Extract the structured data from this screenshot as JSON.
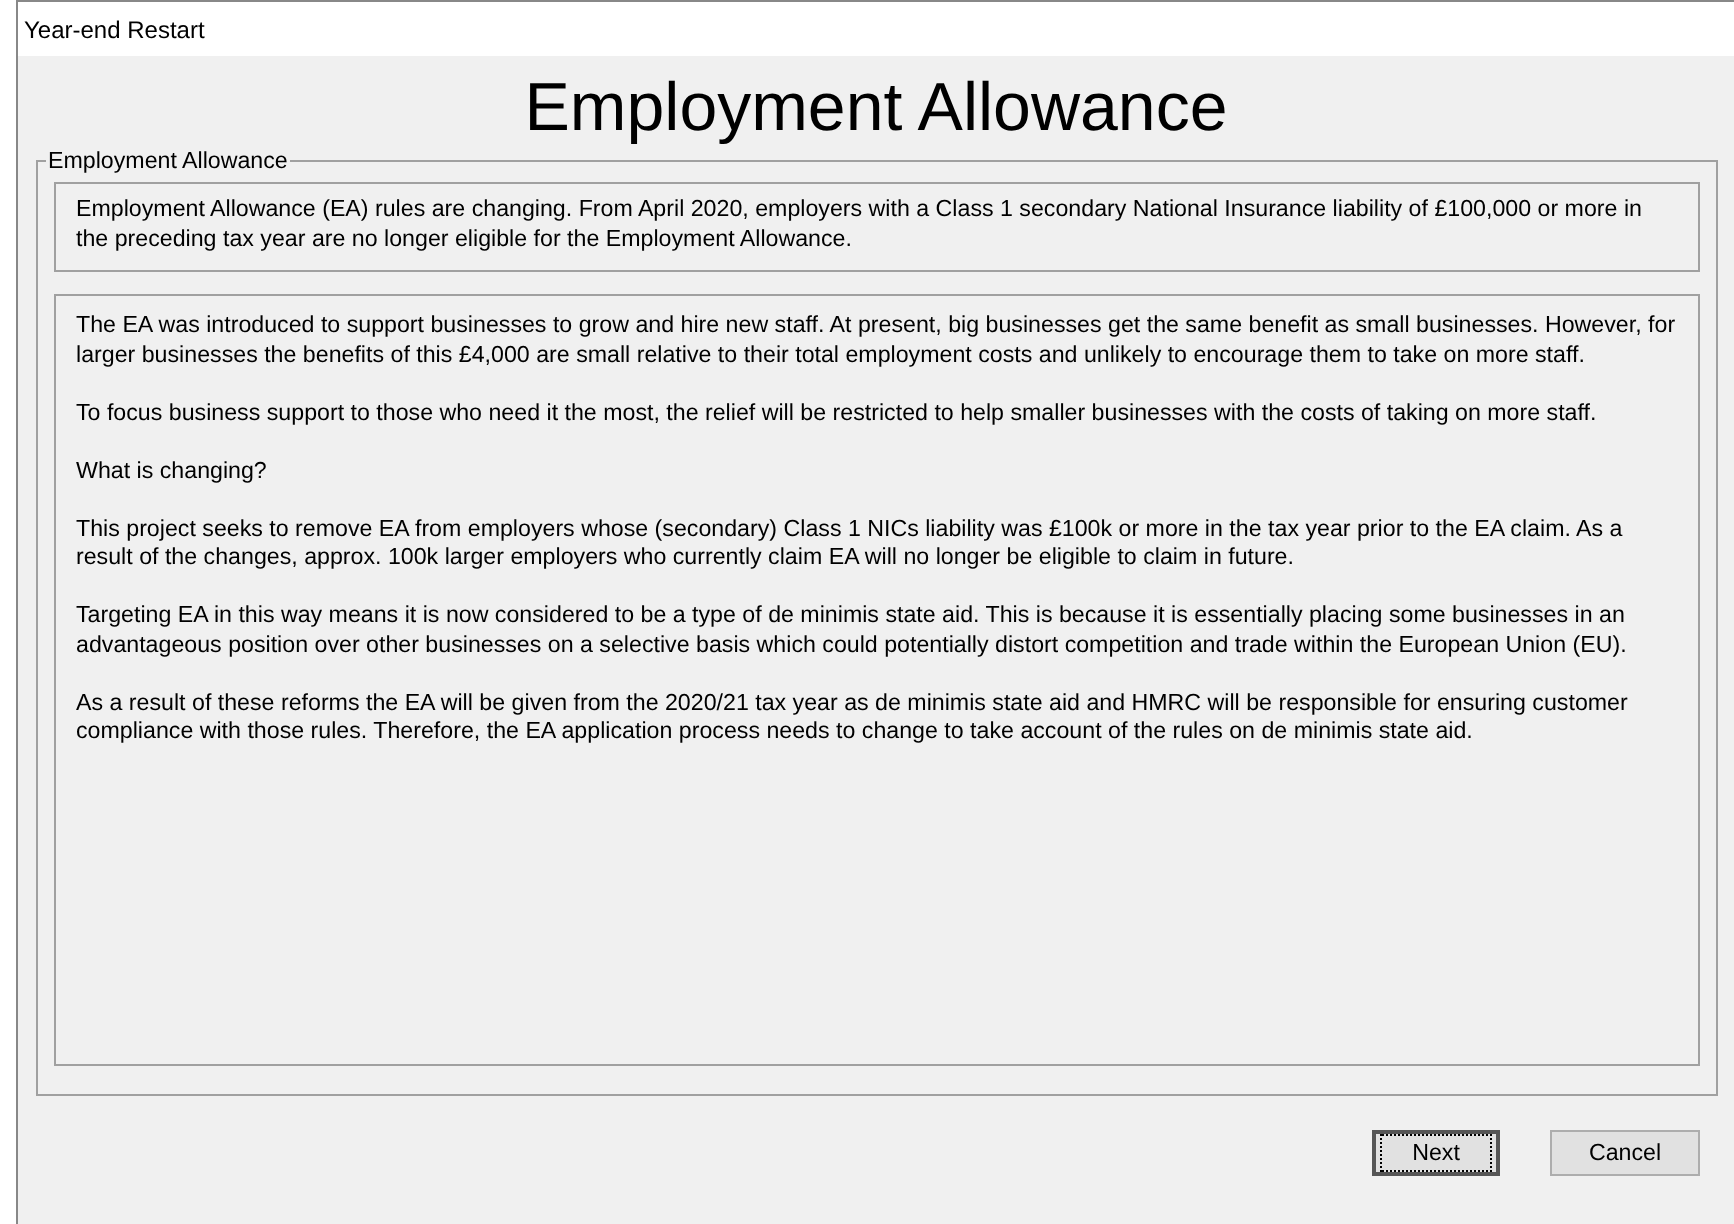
{
  "window": {
    "title": "Year-end Restart"
  },
  "heading": "Employment Allowance",
  "group": {
    "label": "Employment Allowance",
    "summary": "Employment Allowance (EA) rules are changing. From April 2020, employers with a Class 1 secondary National Insurance liability of £100,000 or more in the preceding tax year are no longer eligible for the Employment Allowance.",
    "details": [
      "The EA was introduced to support businesses to grow and hire new staff. At present, big businesses get the same benefit as small businesses. However, for larger businesses the benefits of this £4,000 are small relative to their total employment costs and unlikely to encourage them to take on more staff.",
      "To focus business support to those who need it the most, the relief will be restricted to help smaller businesses with the costs of taking on more staff.",
      "What is changing?",
      "This project seeks to remove EA from employers whose (secondary) Class 1 NICs liability was £100k or more in the tax year prior to the EA claim. As a result of the changes, approx. 100k larger employers who currently claim EA will no longer be eligible to claim in future.",
      "Targeting EA in this way means it is now considered to be a type of de minimis state aid. This is because it is essentially placing some businesses in an advantageous position over other businesses on a selective basis which could potentially distort competition and trade within the European Union (EU).",
      "As a result of these reforms the EA will be given from the 2020/21 tax year as de minimis state aid and HMRC will be responsible for ensuring customer compliance with those rules. Therefore, the EA application process needs to change to take account of the rules on de minimis state aid."
    ]
  },
  "buttons": [
    {
      "label": "Next",
      "default": true
    },
    {
      "label": "Cancel",
      "default": false
    }
  ]
}
